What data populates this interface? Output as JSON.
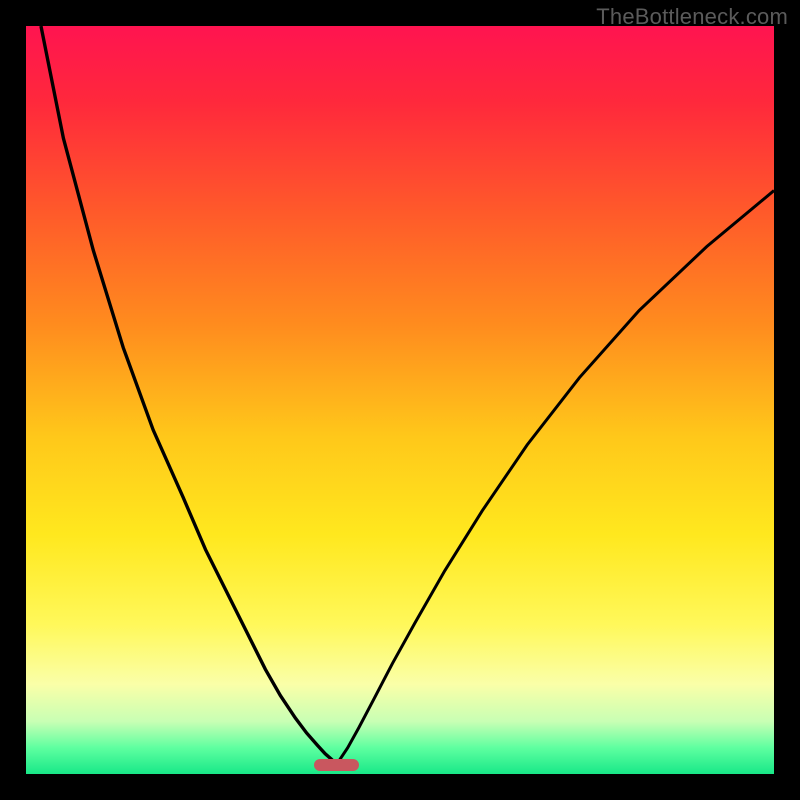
{
  "watermark": {
    "text": "TheBottleneck.com"
  },
  "colors": {
    "bg_outer": "#000000",
    "curve": "#000000",
    "marker": "#c9575f",
    "watermark": "#5b5b5b",
    "gradient_stops": [
      {
        "offset": 0.0,
        "color": "#ff1450"
      },
      {
        "offset": 0.1,
        "color": "#ff283c"
      },
      {
        "offset": 0.25,
        "color": "#ff5a2a"
      },
      {
        "offset": 0.4,
        "color": "#ff8c1e"
      },
      {
        "offset": 0.55,
        "color": "#ffc81a"
      },
      {
        "offset": 0.68,
        "color": "#ffe81e"
      },
      {
        "offset": 0.8,
        "color": "#fff85a"
      },
      {
        "offset": 0.88,
        "color": "#faffa8"
      },
      {
        "offset": 0.93,
        "color": "#c8ffb4"
      },
      {
        "offset": 0.965,
        "color": "#5effa0"
      },
      {
        "offset": 1.0,
        "color": "#18e888"
      }
    ]
  },
  "chart_data": {
    "type": "line",
    "title": "",
    "xlabel": "",
    "ylabel": "",
    "x_range": [
      0,
      100
    ],
    "y_range": [
      0,
      100
    ],
    "marker": {
      "x_center": 41.5,
      "width_pct": 6,
      "y": 98.8
    },
    "series": [
      {
        "name": "left-curve",
        "x": [
          2,
          5,
          9,
          13,
          17,
          21,
          24,
          27,
          30,
          32,
          34,
          36,
          37.5,
          39,
          40,
          40.8,
          41.3,
          41.5
        ],
        "y": [
          0,
          15,
          30,
          43,
          54,
          63,
          70,
          76,
          82,
          86,
          89.5,
          92.5,
          94.5,
          96.2,
          97.3,
          98.0,
          98.5,
          98.8
        ]
      },
      {
        "name": "right-curve",
        "x": [
          41.5,
          42,
          43,
          44.5,
          46.5,
          49,
          52,
          56,
          61,
          67,
          74,
          82,
          91,
          100
        ],
        "y": [
          98.8,
          98.0,
          96.5,
          93.8,
          90.0,
          85.2,
          79.8,
          72.8,
          64.8,
          56.0,
          47.0,
          38.0,
          29.5,
          22.0
        ]
      }
    ]
  }
}
